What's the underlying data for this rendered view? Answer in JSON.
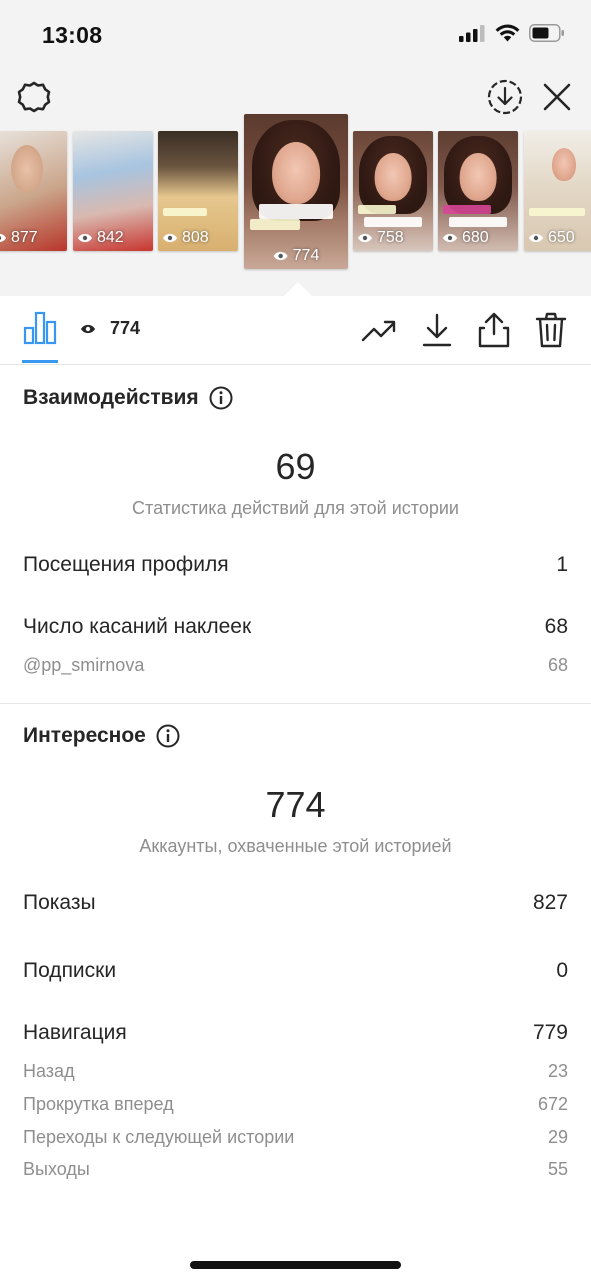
{
  "status_bar": {
    "time": "13:08"
  },
  "stories": [
    {
      "views": "877",
      "colors": [
        "#caa58a",
        "#e9e4df"
      ]
    },
    {
      "views": "842",
      "colors": [
        "#c9b8a6",
        "#a7c4e0"
      ]
    },
    {
      "views": "808",
      "colors": [
        "#5a4836",
        "#e6c78e"
      ]
    },
    {
      "views": "774",
      "colors": [
        "#6b4a3c",
        "#b08a78"
      ],
      "selected": true
    },
    {
      "views": "758",
      "colors": [
        "#7a5a4a",
        "#c09a88"
      ]
    },
    {
      "views": "680",
      "colors": [
        "#6b4a3c",
        "#b8988a"
      ]
    },
    {
      "views": "650",
      "colors": [
        "#e8e4dc",
        "#d9c8b2"
      ]
    }
  ],
  "toolbar": {
    "view_count": "774"
  },
  "interactions": {
    "title": "Взаимодействия",
    "total": "69",
    "caption": "Статистика действий для этой истории",
    "rows": [
      {
        "label": "Посещения профиля",
        "value": "1"
      },
      {
        "label": "Число касаний наклеек",
        "value": "68"
      }
    ],
    "sub_rows": [
      {
        "label": "@pp_smirnova",
        "value": "68"
      }
    ]
  },
  "discovery": {
    "title": "Интересное",
    "total": "774",
    "caption": "Аккаунты, охваченные этой историей",
    "rows": [
      {
        "label": "Показы",
        "value": "827"
      },
      {
        "label": "Подписки",
        "value": "0"
      },
      {
        "label": "Навигация",
        "value": "779"
      }
    ],
    "navigation": [
      {
        "label": "Назад",
        "value": "23"
      },
      {
        "label": "Прокрутка вперед",
        "value": "672"
      },
      {
        "label": "Переходы к следующей истории",
        "value": "29"
      },
      {
        "label": "Выходы",
        "value": "55"
      }
    ]
  },
  "colors": {
    "accent": "#3897f0",
    "text": "#262626",
    "secondary": "#8e8e8e"
  }
}
